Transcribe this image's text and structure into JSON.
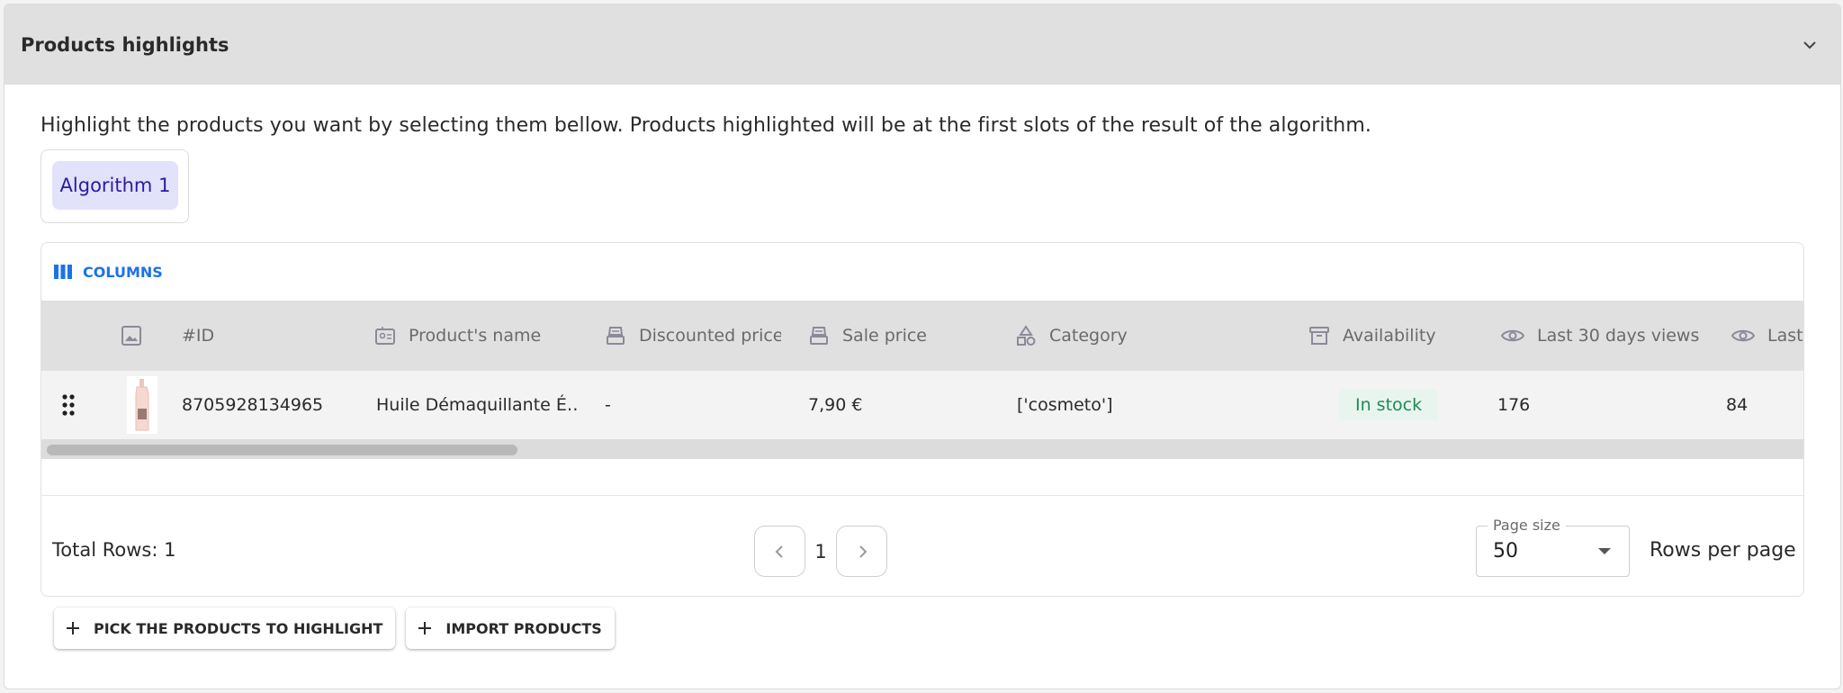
{
  "section": {
    "title": "Products highlights",
    "description": "Highlight the products you want by selecting them bellow. Products highlighted will be at the first slots of the result of the algorithm."
  },
  "algorithms": [
    {
      "label": "Algorithm 1",
      "selected": true
    }
  ],
  "toolbar": {
    "columns_label": "COLUMNS"
  },
  "table": {
    "headers": {
      "id": "#ID",
      "name": "Product's name",
      "discounted_price": "Discounted price",
      "sale_price": "Sale price",
      "category": "Category",
      "availability": "Availability",
      "views_30": "Last 30 days views",
      "views_last": "Last"
    },
    "rows": [
      {
        "id": "8705928134965",
        "name": "Huile Démaquillante É…",
        "discounted_price": "-",
        "sale_price": "7,90 €",
        "category": "['cosmeto']",
        "availability": "In stock",
        "views_30": "176",
        "views_last": "84"
      }
    ]
  },
  "footer": {
    "total_rows": "Total Rows: 1",
    "current_page": "1",
    "page_size_label": "Page size",
    "page_size": "50",
    "rows_per_page": "Rows per page"
  },
  "actions": {
    "pick": "PICK THE PRODUCTS TO HIGHLIGHT",
    "import": "IMPORT PRODUCTS"
  },
  "colors": {
    "accent": "#1a73e8",
    "chip_bg": "#e2e2fb",
    "chip_text": "#2c1aa6",
    "stock_text": "#1e8a55",
    "stock_bg": "#e8f5ef"
  }
}
